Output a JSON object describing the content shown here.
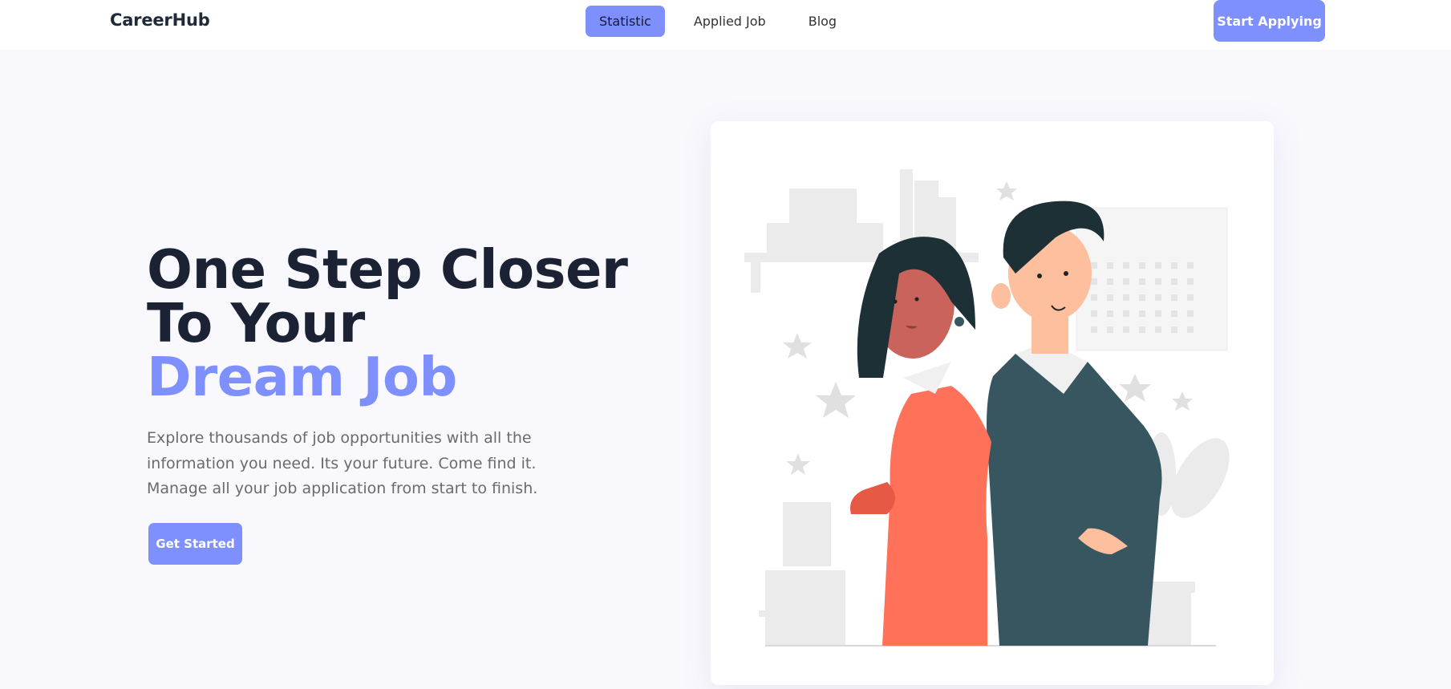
{
  "brand": "CareerHub",
  "nav": {
    "links": [
      {
        "label": "Statistic",
        "active": true
      },
      {
        "label": "Applied Job",
        "active": false
      },
      {
        "label": "Blog",
        "active": false
      }
    ],
    "cta": "Start Applying"
  },
  "hero": {
    "title_line1": "One Step Closer",
    "title_line2": "To Your",
    "title_accent": "Dream Job",
    "description": "Explore thousands of job opportunities with all the information you need. Its your future. Come find it. Manage all your job application from start to finish.",
    "cta": "Get Started"
  },
  "colors": {
    "accent": "#7e90fe",
    "heading": "#1a2233",
    "text_muted": "#6b6b6b",
    "background": "#f8f8fd"
  },
  "illustration": {
    "icon": "business-people-illustration"
  }
}
